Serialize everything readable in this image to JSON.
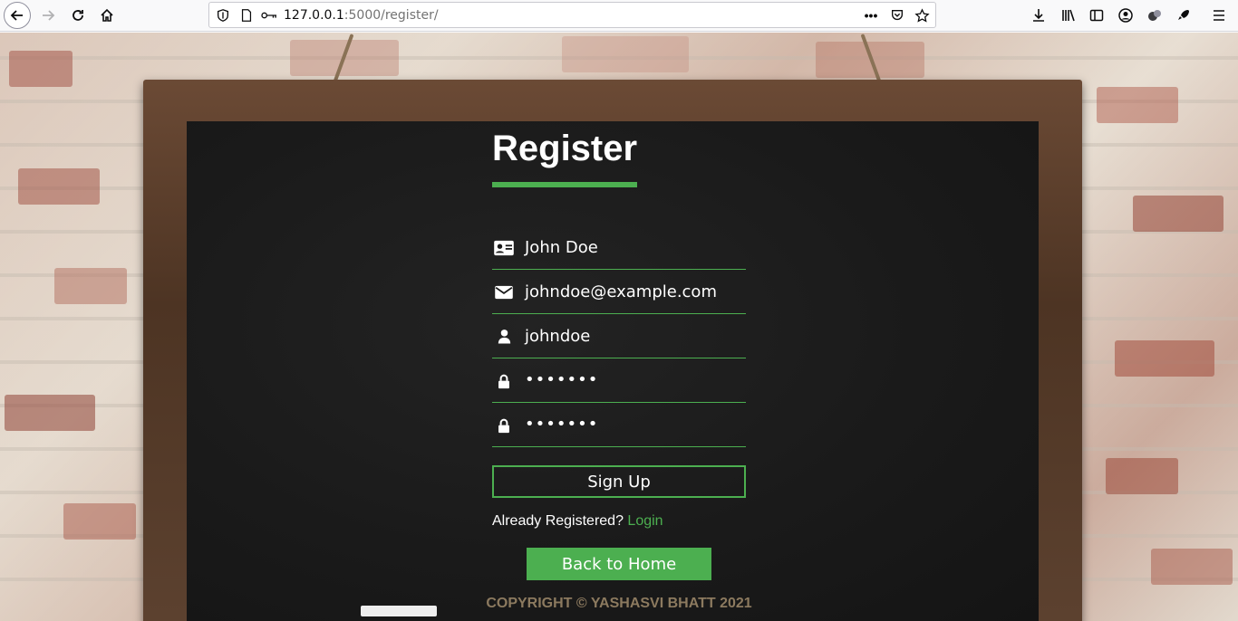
{
  "browser": {
    "url_host": "127.0.0.1",
    "url_path": ":5000/register/",
    "more_label": "•••"
  },
  "form": {
    "title": "Register",
    "fields": [
      {
        "icon": "id-card-icon",
        "value": "John Doe"
      },
      {
        "icon": "envelope-icon",
        "value": "johndoe@example.com"
      },
      {
        "icon": "user-icon",
        "value": "johndoe"
      },
      {
        "icon": "lock-icon",
        "value": "•••••••"
      },
      {
        "icon": "lock-icon",
        "value": "•••••••"
      }
    ],
    "submit_label": "Sign Up",
    "already_text": "Already Registered?",
    "login_link": "Login",
    "home_button": "Back to Home"
  },
  "footer": {
    "copyright": "COPYRIGHT © YASHASVI BHATT 2021"
  },
  "colors": {
    "accent": "#4caf50",
    "board": "#1a1a1a",
    "frame": "#5d4230",
    "footer_text": "#8c7a5f"
  }
}
